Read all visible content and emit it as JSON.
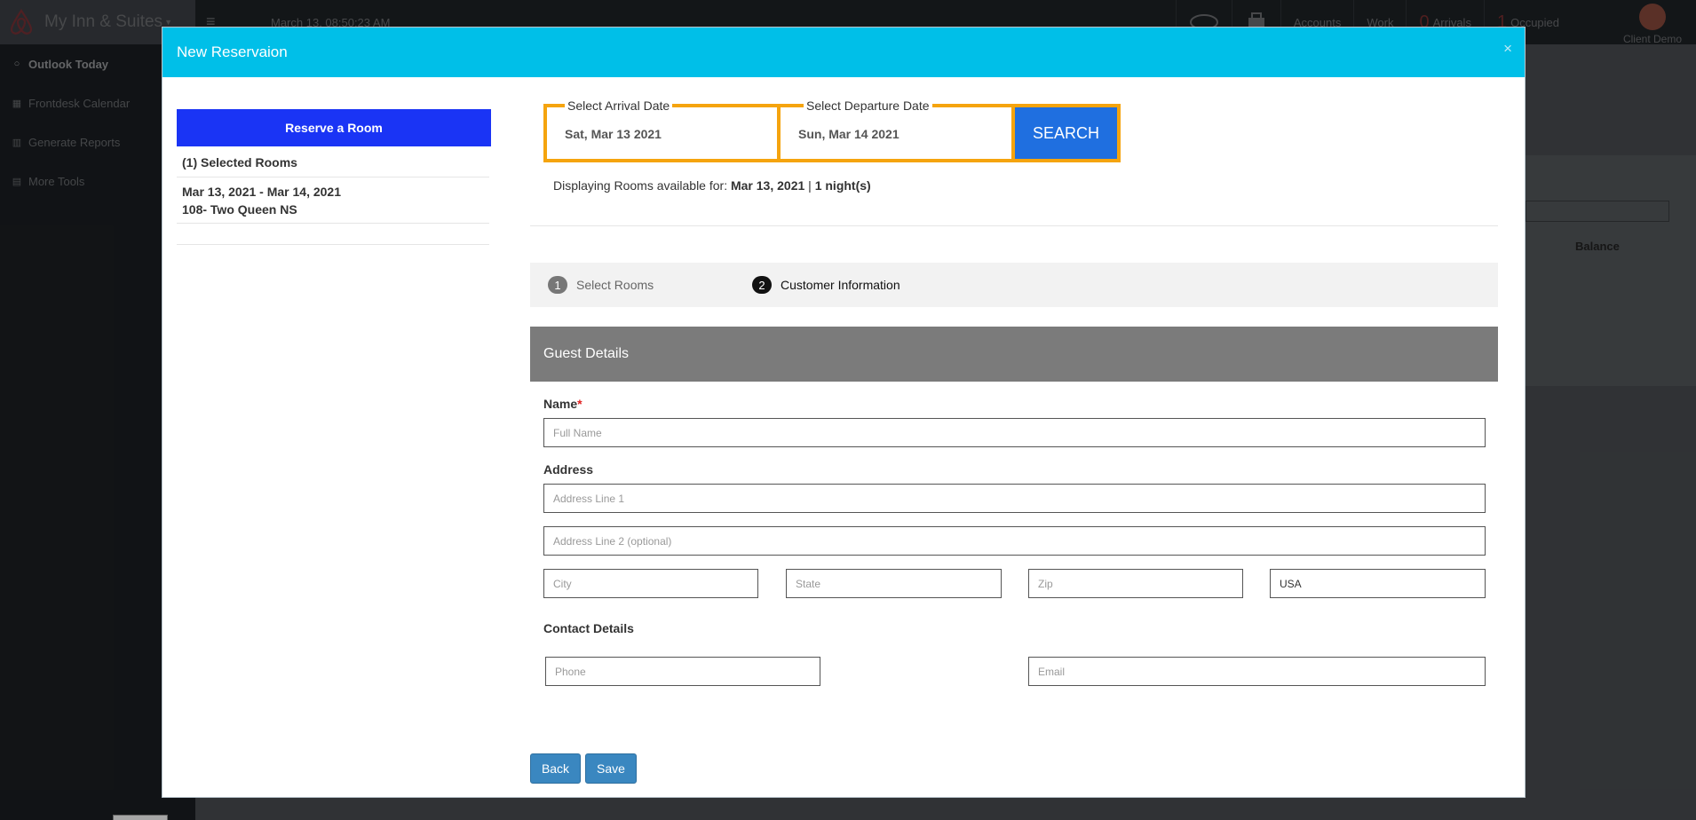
{
  "app": {
    "name": "My Inn & Suites",
    "datetime": "March 13, 08:50:23 AM",
    "top_right": {
      "accounts": "Accounts",
      "work": "Work",
      "arrivals_count": "0",
      "arrivals_label": "Arrivals",
      "occupied_count": "1",
      "occupied_label": "Occupied",
      "user": "Client Demo"
    },
    "sidebar": [
      {
        "label": "Outlook Today",
        "icon": "circle-icon"
      },
      {
        "label": "Frontdesk Calendar",
        "icon": "calendar-icon"
      },
      {
        "label": "Generate Reports",
        "icon": "bar-chart-icon"
      },
      {
        "label": "More Tools",
        "icon": "table-icon"
      }
    ],
    "background_table_header": "Balance"
  },
  "modal": {
    "title": "New Reservaion",
    "close": "×",
    "left": {
      "reserve_label": "Reserve a Room",
      "selected_count": "(1) Selected Rooms",
      "dates": "Mar 13, 2021 - Mar 14, 2021",
      "room": "108- Two Queen NS"
    },
    "search": {
      "arrival_label": "Select Arrival Date",
      "arrival_value": "Sat, Mar 13 2021",
      "departure_label": "Select Departure Date",
      "departure_value": "Sun, Mar 14 2021",
      "button": "SEARCH"
    },
    "display": {
      "prefix": "Displaying Rooms available for: ",
      "date": "Mar 13, 2021",
      "separator": " | ",
      "nights": "1 night(s)"
    },
    "steps": [
      {
        "num": "1",
        "label": "Select Rooms"
      },
      {
        "num": "2",
        "label": "Customer Information"
      }
    ],
    "guest": {
      "heading": "Guest Details",
      "name_label": "Name",
      "required_mark": "*",
      "name_placeholder": "Full Name",
      "address_label": "Address",
      "address1_placeholder": "Address Line 1",
      "address2_placeholder": "Address Line 2 (optional)",
      "city_placeholder": "City",
      "state_placeholder": "State",
      "zip_placeholder": "Zip",
      "country_value": "USA",
      "contact_label": "Contact Details",
      "phone_placeholder": "Phone",
      "email_placeholder": "Email"
    },
    "buttons": {
      "back": "Back",
      "save": "Save"
    }
  },
  "colors": {
    "header": "#00bfe8",
    "reserve_button": "#1a34f5",
    "date_border": "#f5a40e",
    "search_button": "#1f6fe0",
    "action_button": "#3a87c0"
  }
}
